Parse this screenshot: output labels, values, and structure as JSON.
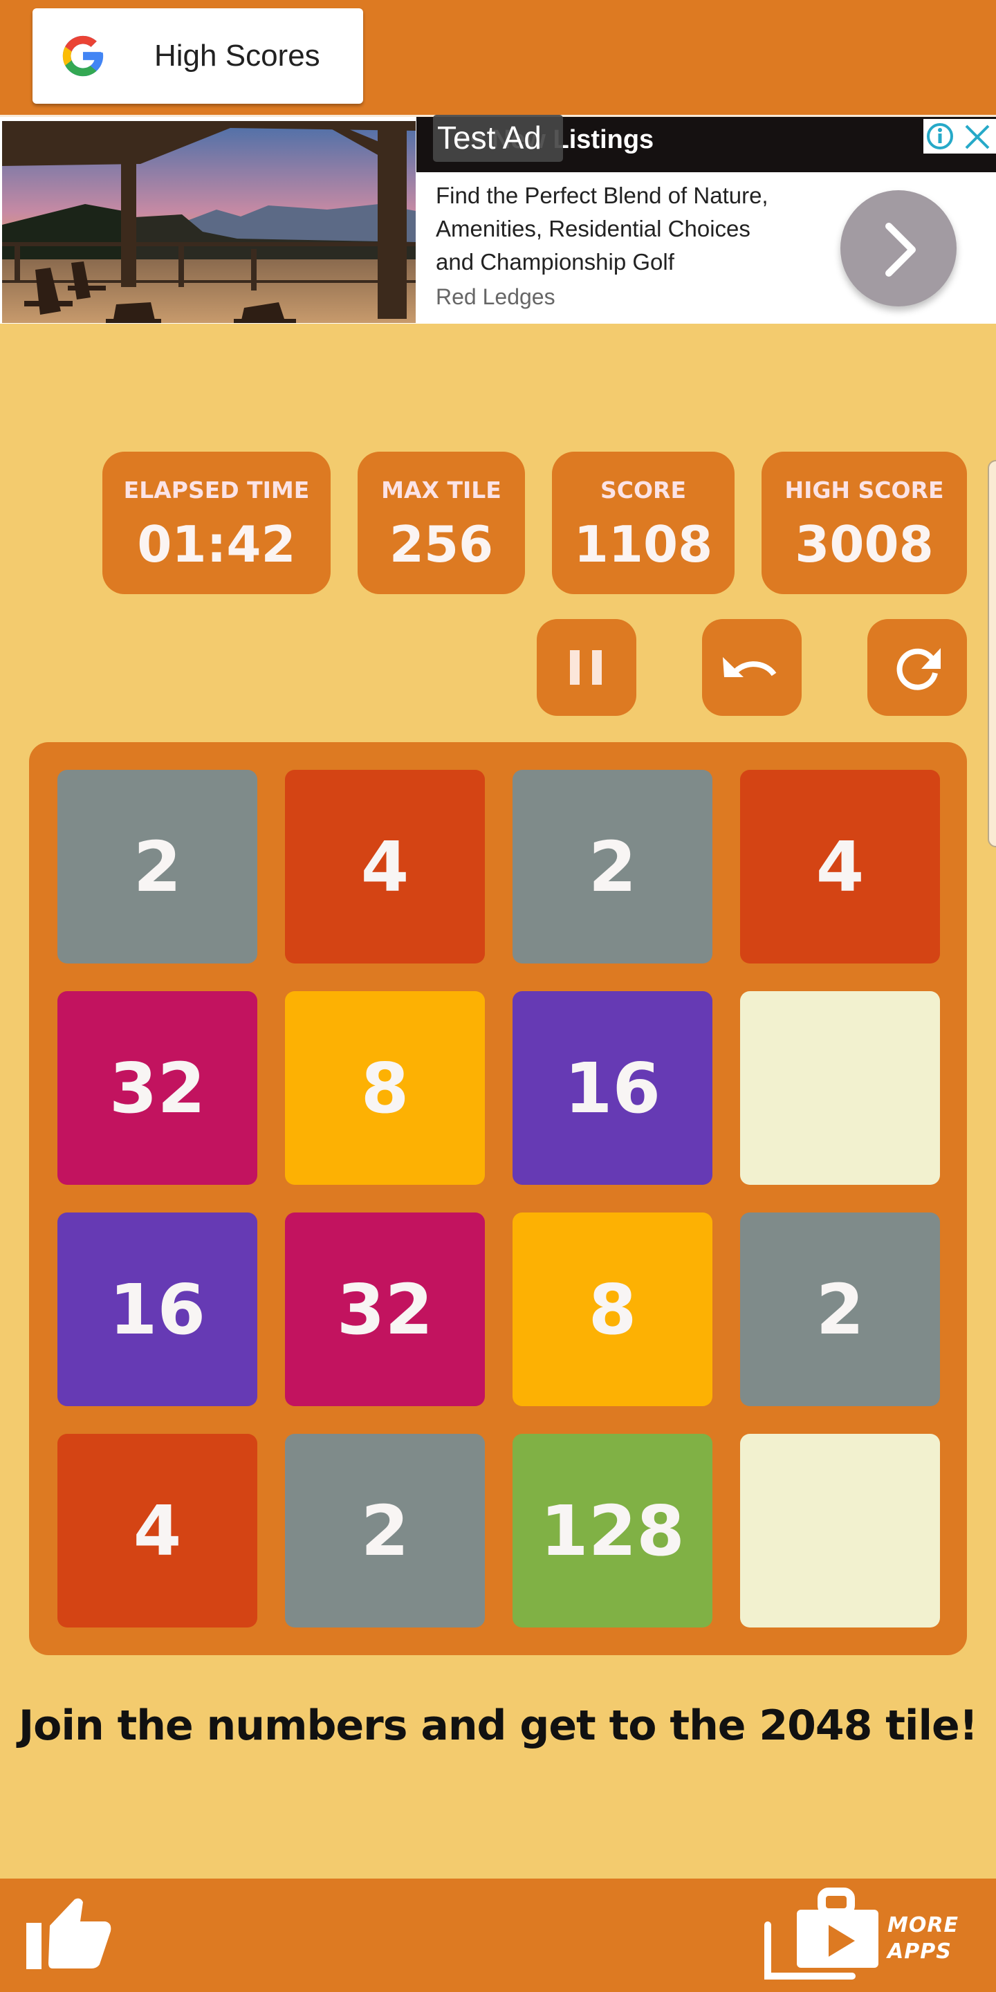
{
  "header": {
    "high_scores_button": "High Scores",
    "google_logo_colors": [
      "#EA4335",
      "#FBBC05",
      "#34A853",
      "#4285F4"
    ]
  },
  "ad": {
    "badge": "Test Ad",
    "headline": "es New Listings",
    "body_lines": [
      "Find the Perfect Blend of Nature,",
      "Amenities, Residential Choices",
      "and Championship Golf"
    ],
    "advertiser": "Red Ledges",
    "image_description": "covered patio with adirondack chairs overlooking mountains at sunset",
    "accent_color": "#26A9C8"
  },
  "stats": [
    {
      "label": "ELAPSED TIME",
      "value": "01:42"
    },
    {
      "label": "MAX TILE",
      "value": "256"
    },
    {
      "label": "SCORE",
      "value": "1108"
    },
    {
      "label": "HIGH SCORE",
      "value": "3008"
    }
  ],
  "controls": [
    {
      "name": "pause",
      "icon": "pause-icon"
    },
    {
      "name": "undo",
      "icon": "undo-icon"
    },
    {
      "name": "restart",
      "icon": "restart-icon"
    }
  ],
  "board": {
    "rows": [
      [
        "2",
        "4",
        "2",
        "4"
      ],
      [
        "32",
        "8",
        "16",
        ""
      ],
      [
        "16",
        "32",
        "8",
        "2"
      ],
      [
        "4",
        "2",
        "128",
        ""
      ]
    ],
    "tile_colors": {
      "": "#F2F1CF",
      "2": "#7F8B8A",
      "4": "#D44414",
      "8": "#FDB103",
      "16": "#663AB4",
      "32": "#C2135F",
      "128": "#80B145"
    }
  },
  "tagline": "Join the numbers and get to the 2048 tile!",
  "footer": {
    "like_icon": "thumbs-up-icon",
    "more_apps_line1": "MORE",
    "more_apps_line2": "APPS"
  },
  "theme": {
    "background": "#F3CB6E",
    "primary": "#DD7A22"
  }
}
